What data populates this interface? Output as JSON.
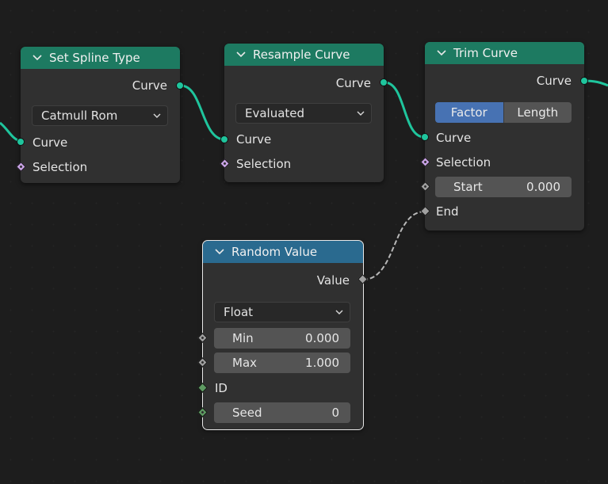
{
  "nodes": {
    "set_spline_type": {
      "title": "Set Spline Type",
      "output_label": "Curve",
      "dropdown_value": "Catmull Rom",
      "inputs": [
        "Curve",
        "Selection"
      ]
    },
    "resample_curve": {
      "title": "Resample Curve",
      "output_label": "Curve",
      "dropdown_value": "Evaluated",
      "inputs": [
        "Curve",
        "Selection"
      ]
    },
    "trim_curve": {
      "title": "Trim Curve",
      "output_label": "Curve",
      "mode_options": [
        "Factor",
        "Length"
      ],
      "mode_active": "Factor",
      "inputs": [
        "Curve",
        "Selection"
      ],
      "start_label": "Start",
      "start_value": "0.000",
      "end_label": "End"
    },
    "random_value": {
      "title": "Random Value",
      "output_label": "Value",
      "dropdown_value": "Float",
      "min_label": "Min",
      "min_value": "0.000",
      "max_label": "Max",
      "max_value": "1.000",
      "id_label": "ID",
      "seed_label": "Seed",
      "seed_value": "0"
    }
  },
  "colors": {
    "geometry_header": "#1d7a61",
    "input_header": "#2a6a8f",
    "geometry_socket": "#1fc59d",
    "field_socket": "#c9a3e6",
    "float_socket": "#a0a0a0",
    "int_socket": "#5e9a62",
    "active_toggle": "#4772b3"
  }
}
